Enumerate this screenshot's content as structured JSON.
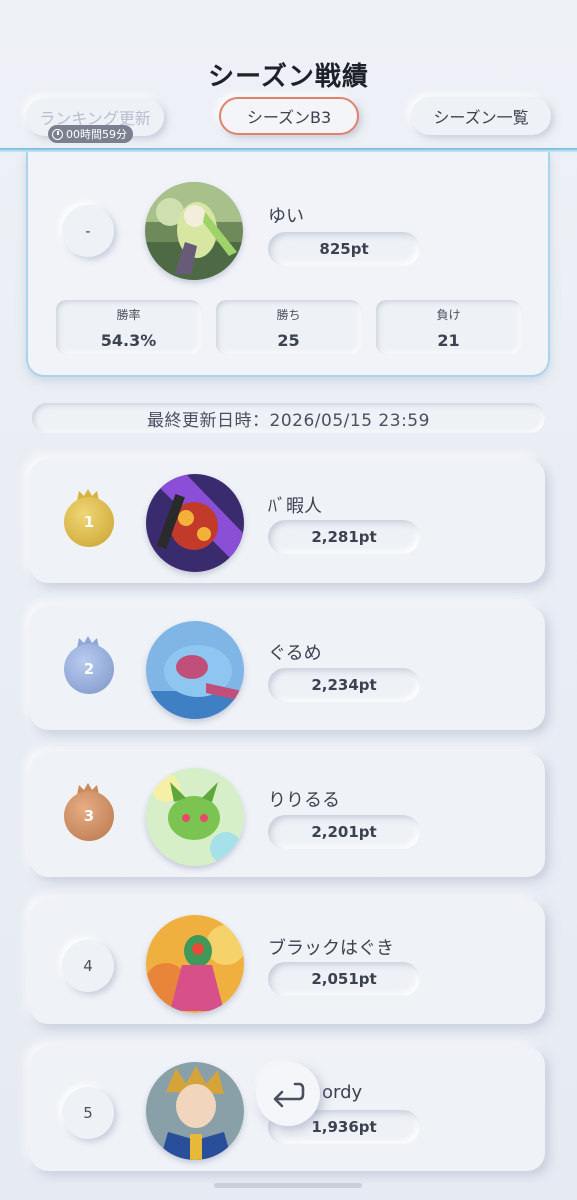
{
  "header": {
    "title": "シーズン戦績",
    "ranking_update_label": "ランキング更新",
    "timer": "00時間59分",
    "current_season_label": "シーズンB3",
    "season_list_label": "シーズン一覧"
  },
  "my_record": {
    "rank": "-",
    "name": "ゆい",
    "points": "825pt",
    "stats": [
      {
        "label": "勝率",
        "value": "54.3%"
      },
      {
        "label": "勝ち",
        "value": "25"
      },
      {
        "label": "負け",
        "value": "21"
      }
    ]
  },
  "last_updated": "最終更新日時：2026/05/15 23:59",
  "ranking": [
    {
      "rank": "1",
      "name": "ﾊﾞ暇人",
      "points": "2,281pt",
      "medal": "gold"
    },
    {
      "rank": "2",
      "name": "ぐるめ",
      "points": "2,234pt",
      "medal": "silver"
    },
    {
      "rank": "3",
      "name": "りりるる",
      "points": "2,201pt",
      "medal": "bronze"
    },
    {
      "rank": "4",
      "name": "ブラックはぐき",
      "points": "2,051pt",
      "medal": "none"
    },
    {
      "rank": "5",
      "name": "ordy",
      "points": "1,936pt",
      "medal": "none"
    }
  ],
  "colors": {
    "gold": "#d8b43c",
    "silver": "#8fa8d6",
    "bronze": "#c98a5c",
    "accent": "#e0836a"
  },
  "icons": {
    "back_button": "return-arrow-icon",
    "timer": "clock-icon",
    "crown": "crown-icon"
  }
}
